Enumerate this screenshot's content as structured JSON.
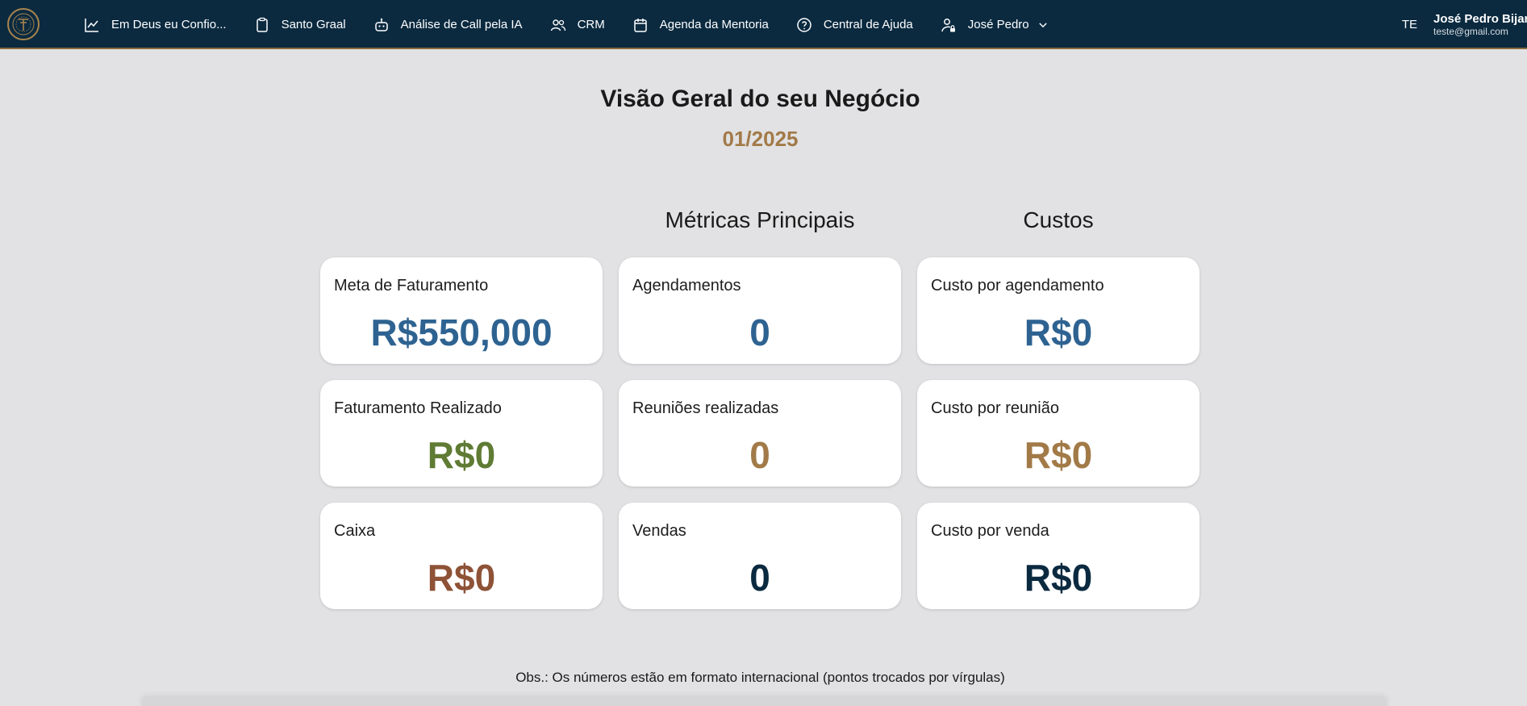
{
  "colors": {
    "topbar_bg": "#0b2a40",
    "accent_gold": "#a27a48",
    "value_blue": "#2e6391",
    "value_green": "#5f7b34",
    "value_brown": "#8e5237",
    "value_navy": "#0b2a40"
  },
  "nav": {
    "items": [
      {
        "label": "Em Deus eu Confio...",
        "icon": "chart-line-icon"
      },
      {
        "label": "Santo Graal",
        "icon": "clipboard-icon"
      },
      {
        "label": "Análise de Call pela IA",
        "icon": "robot-icon"
      },
      {
        "label": "CRM",
        "icon": "users-icon"
      },
      {
        "label": "Agenda da Mentoria",
        "icon": "calendar-icon"
      },
      {
        "label": "Central de Ajuda",
        "icon": "help-circle-icon"
      },
      {
        "label": "José Pedro",
        "icon": "user-lock-icon"
      }
    ]
  },
  "user": {
    "initials": "TE",
    "name": "José Pedro Bijari",
    "email": "teste@gmail.com"
  },
  "header": {
    "title": "Visão Geral do seu Negócio",
    "period": "01/2025"
  },
  "sections": {
    "main_metrics": "Métricas Principais",
    "costs": "Custos"
  },
  "cards": [
    {
      "label": "Meta de Faturamento",
      "value": "R$550,000",
      "color": "#2e6391"
    },
    {
      "label": "Agendamentos",
      "value": "0",
      "color": "#2e6391"
    },
    {
      "label": "Custo por agendamento",
      "value": "R$0",
      "color": "#2e6391"
    },
    {
      "label": "Faturamento Realizado",
      "value": "R$0",
      "color": "#5f7b34"
    },
    {
      "label": "Reuniões realizadas",
      "value": "0",
      "color": "#a27a48"
    },
    {
      "label": "Custo por reunião",
      "value": "R$0",
      "color": "#a27a48"
    },
    {
      "label": "Caixa",
      "value": "R$0",
      "color": "#8e5237"
    },
    {
      "label": "Vendas",
      "value": "0",
      "color": "#0b2a40"
    },
    {
      "label": "Custo por venda",
      "value": "R$0",
      "color": "#0b2a40"
    }
  ],
  "footnote": "Obs.: Os números estão em formato internacional (pontos trocados por vírgulas)"
}
